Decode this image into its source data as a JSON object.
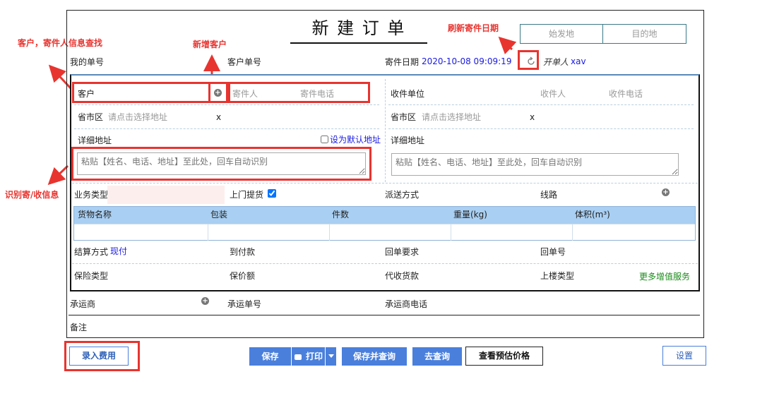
{
  "title": "新 建 订 单",
  "tabs": {
    "origin": "始发地",
    "destination": "目的地"
  },
  "annotations": {
    "lookup": "客户，寄件人信息查找",
    "new_customer": "新增客户",
    "refresh_date": "刷新寄件日期",
    "recognize": "识别寄/收信息"
  },
  "header": {
    "my_order_no": "我的单号",
    "customer_order_no": "客户单号",
    "send_date_label": "寄件日期",
    "send_date_value": "2020-10-08 09:09:19",
    "operator_label": "开单人",
    "operator_value": "xav"
  },
  "sender": {
    "customer_label": "客户",
    "sender_placeholder": "寄件人",
    "phone_placeholder": "寄件电话",
    "region_label": "省市区",
    "region_placeholder": "请点击选择地址",
    "clear": "x",
    "detail_label": "详细地址",
    "default_checkbox_label": "设为默认地址",
    "paste_placeholder": "粘贴【姓名、电话、地址】至此处，回车自动识别"
  },
  "receiver": {
    "unit_label": "收件单位",
    "receiver_placeholder": "收件人",
    "phone_placeholder": "收件电话",
    "region_label": "省市区",
    "region_placeholder": "请点击选择地址",
    "clear": "x",
    "detail_label": "详细地址",
    "paste_placeholder": "粘贴【姓名、电话、地址】至此处，回车自动识别"
  },
  "service": {
    "business_type": "业务类型",
    "pickup": "上门提货",
    "delivery_method": "派送方式",
    "route": "线路"
  },
  "goods_table": {
    "columns": [
      "货物名称",
      "包装",
      "件数",
      "重量(kg)",
      "体积(m³)"
    ]
  },
  "settlement": {
    "method_label": "结算方式",
    "method_value": "现付",
    "cod_freight": "到付款",
    "receipt_req": "回单要求",
    "receipt_no": "回单号",
    "insurance_type": "保险类型",
    "insured_amount": "保价额",
    "collect_payment": "代收货款",
    "stairs_type": "上楼类型",
    "more_services": "更多增值服务"
  },
  "carrier": {
    "carrier_label": "承运商",
    "carrier_no": "承运单号",
    "carrier_phone": "承运商电话"
  },
  "remarks": "备注",
  "buttons": {
    "enter_fee": "录入费用",
    "save": "保存",
    "print": "打印",
    "save_query": "保存并查询",
    "go_query": "去查询",
    "view_price": "查看预估价格",
    "settings": "设置"
  },
  "colors": {
    "accent": "#4a7fdc",
    "annotation": "#e8342f",
    "table_header": "#a9cff2"
  }
}
